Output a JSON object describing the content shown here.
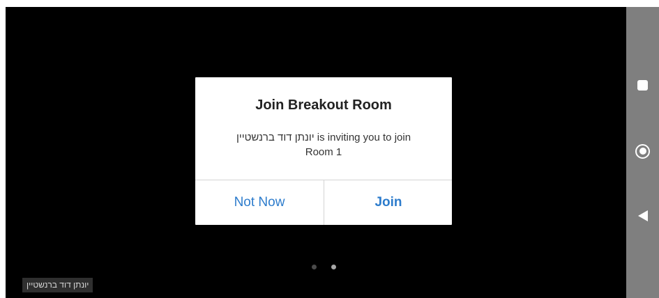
{
  "dialog": {
    "title": "Join Breakout Room",
    "message_line1": "יונתן דוד ברנשטיין is inviting you to join",
    "message_line2": "Room 1",
    "not_now_label": "Not Now",
    "join_label": "Join"
  },
  "participant": {
    "name": "יונתן דוד ברנשטיין"
  },
  "pager": {
    "page_count": 2,
    "active_page": 2
  },
  "nav": {
    "icons": [
      "recent-apps-icon",
      "home-icon",
      "back-icon"
    ]
  },
  "colors": {
    "accent": "#2d7ccc",
    "video_bg": "#000000",
    "nav_bar": "#7f7f7f",
    "dialog_bg": "#ffffff"
  }
}
